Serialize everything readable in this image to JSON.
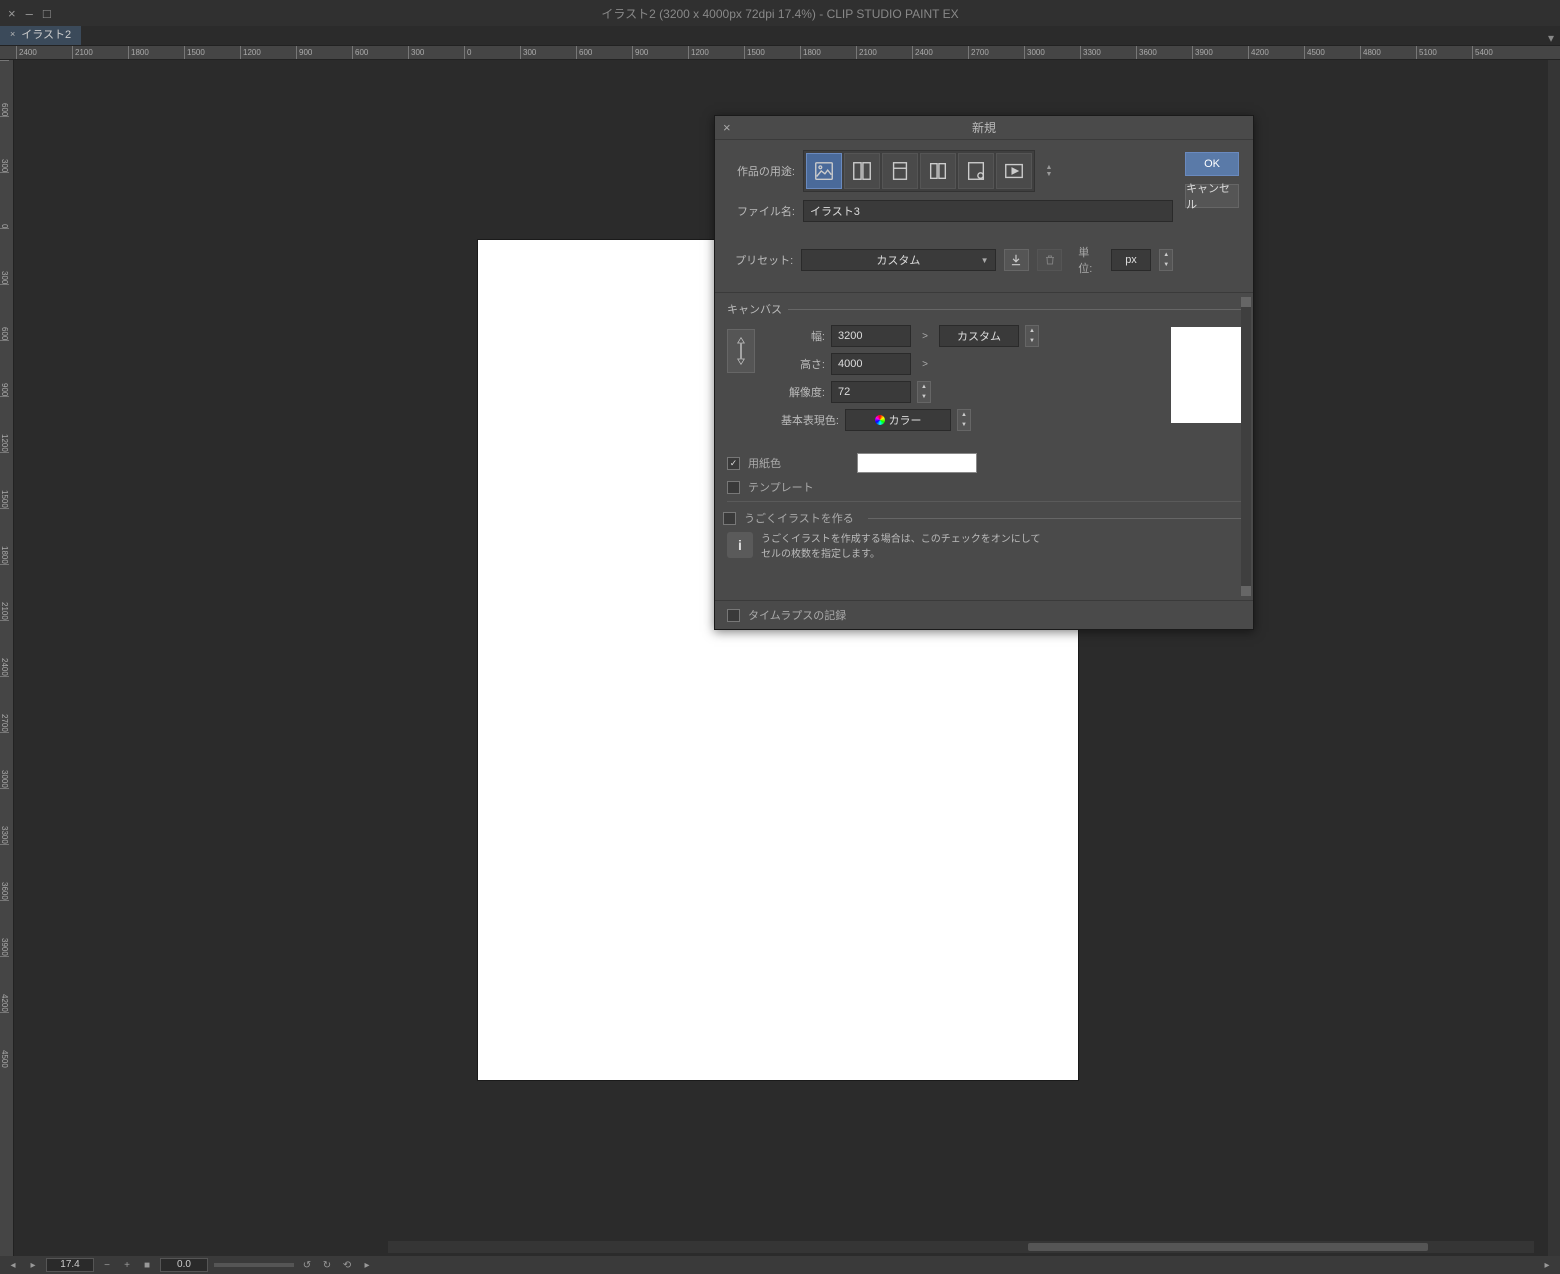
{
  "titlebar": {
    "title": "イラスト2 (3200 x 4000px 72dpi 17.4%)  - CLIP STUDIO PAINT EX"
  },
  "tabs": {
    "active": "イラスト2"
  },
  "ruler_top": [
    "2400",
    "2100",
    "1800",
    "1500",
    "1200",
    "900",
    "600",
    "300",
    "0",
    "300",
    "600",
    "900",
    "1200",
    "1500",
    "1800",
    "2100",
    "2400",
    "2700",
    "3000",
    "3300",
    "3600",
    "3900",
    "4200",
    "4500",
    "4800",
    "5100",
    "5400"
  ],
  "ruler_left": [
    "600",
    "300",
    "0",
    "300",
    "600",
    "900",
    "1200",
    "1500",
    "1800",
    "2100",
    "2400",
    "2700",
    "3000",
    "3300",
    "3600",
    "3900",
    "4200",
    "4500"
  ],
  "statusbar": {
    "zoom": "17.4",
    "rot": "0.0"
  },
  "dialog": {
    "title": "新規",
    "ok": "OK",
    "cancel": "キャンセル",
    "purpose_label": "作品の用途:",
    "filename_label": "ファイル名:",
    "filename_value": "イラスト3",
    "preset_label": "プリセット:",
    "preset_value": "カスタム",
    "unit_label": "単位:",
    "unit_value": "px",
    "canvas_section": "キャンバス",
    "width_label": "幅:",
    "width_value": "3200",
    "height_label": "高さ:",
    "height_value": "4000",
    "size_preset": "カスタム",
    "resolution_label": "解像度:",
    "resolution_value": "72",
    "colormode_label": "基本表現色:",
    "colormode_value": "カラー",
    "papercolor_label": "用紙色",
    "template_label": "テンプレート",
    "anim_label": "うごくイラストを作る",
    "anim_hint": "うごくイラストを作成する場合は、このチェックをオンにして\nセルの枚数を指定します。",
    "timelapse_label": "タイムラプスの記録"
  }
}
